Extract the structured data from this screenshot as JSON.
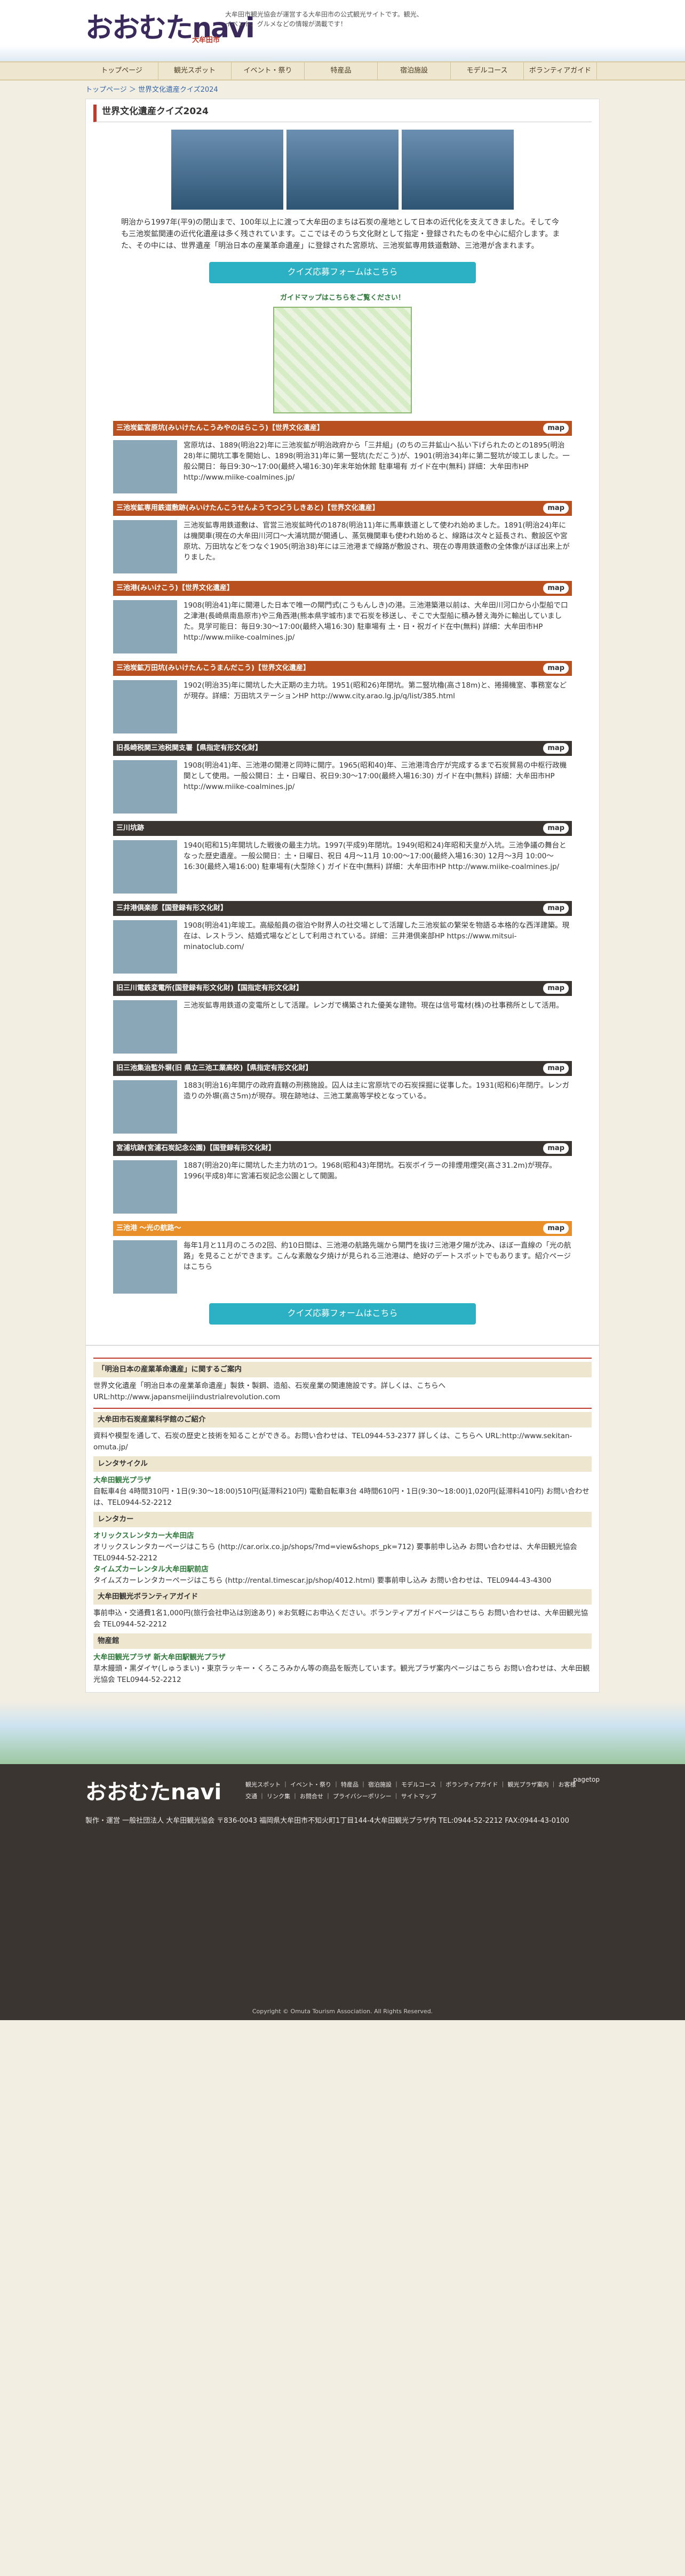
{
  "header": {
    "logo": "おおむたnavi",
    "logo_sub": "大牟田市",
    "tagline": "大牟田市観光協会が運営する大牟田市の公式観光サイトです。観光、イベント、グルメなどの情報が満載です！"
  },
  "nav": [
    "トップページ",
    "観光スポット",
    "イベント・祭り",
    "特産品",
    "宿泊施設",
    "モデルコース",
    "ボランティアガイド"
  ],
  "breadcrumb": "トップページ ＞ 世界文化遺産クイズ2024",
  "title": "世界文化遺産クイズ2024",
  "intro": "明治から1997年(平9)の閉山まで、100年以上に渡って大牟田のまちは石炭の産地として日本の近代化を支えてきました。そして今も三池炭鉱関連の近代化遺産は多く残されています。ここではそのうち文化財として指定・登録されたものを中心に紹介します。また、その中には、世界遺産「明治日本の産業革命遺産」に登録された宮原坑、三池炭鉱専用鉄道敷跡、三池港が含まれます。",
  "quiz_button": "クイズ応募フォームはこちら",
  "guide_map": "ガイドマップはこちらをご覧ください！",
  "map_label": "map",
  "sites": [
    {
      "head": "三池炭鉱宮原坑(みいけたんこうみやのはらこう)【世界文化遺産】",
      "color": "#b8501f",
      "text": "宮原坑は、1889(明治22)年に三池炭鉱が明治政府から「三井組」(のちの三井鉱山へ払い下げられたのとの1895(明治28)年に開坑工事を開始し、1898(明治31)年に第一竪坑(ただこう)が、1901(明治34)年に第二竪坑が竣工しました。一般公開日：毎日9:30〜17:00(最終入場16:30)年末年始休館 駐車場有 ガイド在中(無料) 詳細：大牟田市HP http://www.miike-coalmines.jp/"
    },
    {
      "head": "三池炭鉱専用鉄道敷跡(みいけたんこうせんようてつどうしきあと)【世界文化遺産】",
      "color": "#b8501f",
      "text": "三池炭鉱専用鉄道敷は、官営三池炭鉱時代の1878(明治11)年に馬車鉄道として使われ始めました。1891(明治24)年には機関車(現在の大牟田川河口〜大浦坑間が開通し、蒸気機関車も使われ始めると、線路は次々と延長され、敷設区や宮原坑、万田坑などをつなぐ1905(明治38)年には三池港まで線路が敷設され、現在の専用鉄道敷の全体像がほぼ出来上がりました。"
    },
    {
      "head": "三池港(みいけこう)【世界文化遺産】",
      "color": "#b8501f",
      "text": "1908(明治41)年に開港した日本で唯一の閘門式(こうもんしき)の港。三池港築港以前は、大牟田川河口から小型船で口之津港(長崎県南島原市)や三角西港(熊本県宇城市)まで石炭を移送し、そこで大型船に積み替え海外に輸出していました。見学可能日：毎日9:30〜17:00(最終入場16:30) 駐車場有 土・日・祝ガイド在中(無料) 詳細：大牟田市HP http://www.miike-coalmines.jp/"
    },
    {
      "head": "三池炭鉱万田坑(みいけたんこうまんだこう)【世界文化遺産】",
      "color": "#b8501f",
      "text": "1902(明治35)年に開坑した大正期の主力坑。1951(昭和26)年閉坑。第二竪坑櫓(高さ18m)と、捲揚機室、事務室などが現存。詳細：万田坑ステーションHP http://www.city.arao.lg.jp/q/list/385.html"
    },
    {
      "head": "旧長崎税関三池税関支署【県指定有形文化財】",
      "color": "#3b3531",
      "text": "1908(明治41)年、三池港の開港と同時に開庁。1965(昭和40)年、三池港湾合庁が完成するまで石炭貿易の中枢行政機関として使用。一般公開日：土・日曜日、祝日9:30〜17:00(最終入場16:30) ガイド在中(無料) 詳細：大牟田市HP http://www.miike-coalmines.jp/"
    },
    {
      "head": "三川坑跡",
      "color": "#3b3531",
      "text": "1940(昭和15)年開坑した戦後の最主力坑。1997(平成9)年閉坑。1949(昭和24)年昭和天皇が入坑。三池争議の舞台となった歴史遺産。一般公開日：土・日曜日、祝日 4月〜11月 10:00〜17:00(最終入場16:30) 12月〜3月 10:00〜16:30(最終入場16:00) 駐車場有(大型除く) ガイド在中(無料) 詳細：大牟田市HP http://www.miike-coalmines.jp/"
    },
    {
      "head": "三井港倶楽部【国登録有形文化財】",
      "color": "#3b3531",
      "text": "1908(明治41)年竣工。高級船員の宿泊や財界人の社交場として活躍した三池炭鉱の繁栄を物語る本格的な西洋建築。現在は、レストラン、結婚式場などとして利用されている。詳細：三井港倶楽部HP https://www.mitsui-minatoclub.com/"
    },
    {
      "head": "旧三川電鉄変電所(国登録有形文化財)【国指定有形文化財】",
      "color": "#3b3531",
      "text": "三池炭鉱専用鉄道の変電所として活躍。レンガで構築された優美な建物。現在は信号電材(株)の社事務所として活用。"
    },
    {
      "head": "旧三池集治監外塀(旧 県立三池工業高校)【県指定有形文化財】",
      "color": "#3b3531",
      "text": "1883(明治16)年開庁の政府直轄の刑務施設。囚人は主に宮原坑での石炭採掘に従事した。1931(昭和6)年閉庁。レンガ造りの外塀(高さ5m)が現存。現在跡地は、三池工業高等学校となっている。"
    },
    {
      "head": "宮浦坑跡(宮浦石炭記念公園)【国登録有形文化財】",
      "color": "#3b3531",
      "text": "1887(明治20)年に開坑した主力坑の1つ。1968(昭和43)年閉坑。石炭ボイラーの排煙用煙突(高さ31.2m)が現存。1996(平成8)年に宮浦石炭記念公園として開園。"
    },
    {
      "head": "三池港 〜光の航路〜",
      "color": "#e88f2a",
      "text": "毎年1月と11月のころの2回、約10日間は、三池港の航路先端から閘門を抜け三池港夕陽が沈み、ほぼ一直線の「光の航路」を見ることができます。こんな素敵な夕焼けが見られる三池港は、絶好のデートスポットでもあります。紹介ページはこちら"
    }
  ],
  "footer_info": {
    "heritage_title": "「明治日本の産業革命遺産」に関するご案内",
    "heritage_text": "世界文化遺産「明治日本の産業革命遺産」製鉄・製鋼、造船、石炭産業の関連施設です。詳しくは、こちらへ URL:http://www.japansmeijiindustrialrevolution.com",
    "museum_title": "大牟田市石炭産業科学館のご紹介",
    "museum_text": "資料や模型を通して、石炭の歴史と技術を知ることができる。お問い合わせは、TEL0944-53-2377 詳しくは、こちらへ URL:http://www.sekitan-omuta.jp/",
    "rental_title": "レンタサイクル",
    "rental_name": "大牟田観光プラザ",
    "rental_text": "自転車4台 4時間310円・1日(9:30〜18:00)510円(延滞料210円) 電動自転車3台 4時間610円・1日(9:30〜18:00)1,020円(延滞料410円) お問い合わせは、TEL0944-52-2212",
    "car_title": "レンタカー",
    "car1": "オリックスレンタカー大牟田店",
    "car1_text": "オリックスレンタカーページはこちら (http://car.orix.co.jp/shops/?md=view&shops_pk=712) 要事前申し込み お問い合わせは、大牟田観光協会 TEL0944-52-2212",
    "car2": "タイムズカーレンタル大牟田駅前店",
    "car2_text": "タイムズカーレンタカーページはこちら (http://rental.timescar.jp/shop/4012.html) 要事前申し込み お問い合わせは、TEL0944-43-4300",
    "vol_title": "大牟田観光ボランティアガイド",
    "vol_text": "事前申込・交通費1名1,000円(旅行会社申込は別途あり) ※お気軽にお申込ください。ボランティアガイドページはこちら お問い合わせは、大牟田観光協会 TEL0944-52-2212",
    "goods_title": "物産館",
    "goods_name": "大牟田観光プラザ 新大牟田駅観光プラザ",
    "goods_text": "草木饅頭・黒ダイヤ(しゅうまい)・東京ラッキー・くろころみかん等の商品を販売しています。観光プラザ案内ページはこちら お問い合わせは、大牟田観光協会 TEL0944-52-2212"
  },
  "footer": {
    "logo": "おおむたnavi",
    "links": "観光スポット ｜ イベント・祭り ｜ 特産品 ｜ 宿泊施設 ｜ モデルコース ｜ ボランティアガイド ｜ 観光プラザ案内 ｜ お客様交通 ｜ リンク集 ｜ お問合せ ｜ プライバシーポリシー ｜ サイトマップ",
    "pagetop": "pagetop",
    "address": "製作・運営 一般社団法人 大牟田観光協会 〒836-0043 福岡県大牟田市不知火町1丁目144-4大牟田観光プラザ内 TEL:0944-52-2212 FAX:0944-43-0100",
    "copyright": "Copyright © Omuta Tourism Association. All Rights Reserved."
  }
}
